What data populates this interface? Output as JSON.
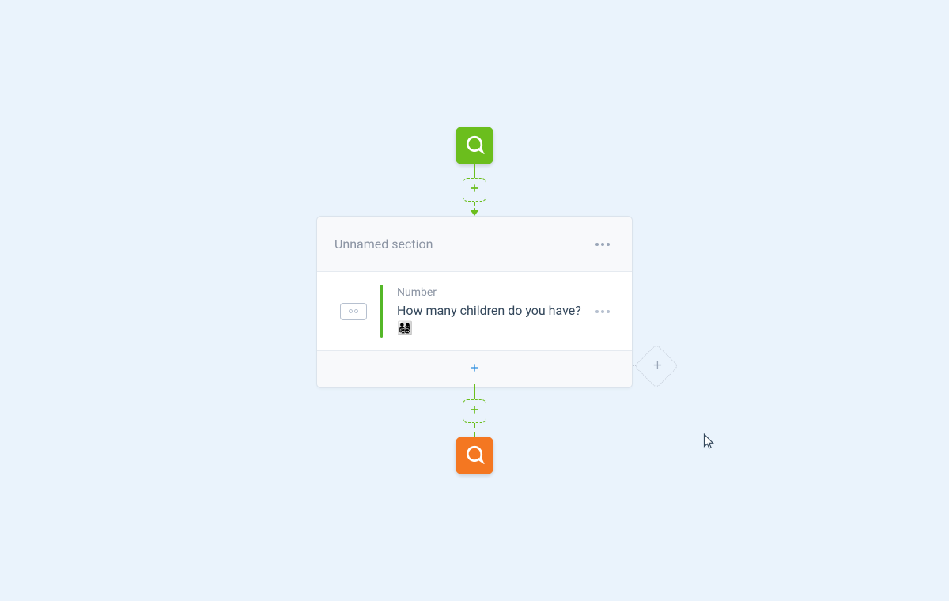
{
  "section": {
    "title": "Unnamed section",
    "question": {
      "type_label": "Number",
      "text": "How many children do you have? 👨‍👩‍👧‍👦"
    }
  },
  "icons": {
    "start_node": "chat-bubble-icon",
    "end_node": "chat-bubble-icon",
    "add": "plus-icon",
    "number_field": "number-field-icon",
    "branch_add": "plus-icon",
    "more": "more-horizontal-icon"
  },
  "colors": {
    "start": "#6bbe1d",
    "end": "#f47721",
    "canvas_bg": "#eaf3fc",
    "accent_blue": "#2a8dde"
  }
}
